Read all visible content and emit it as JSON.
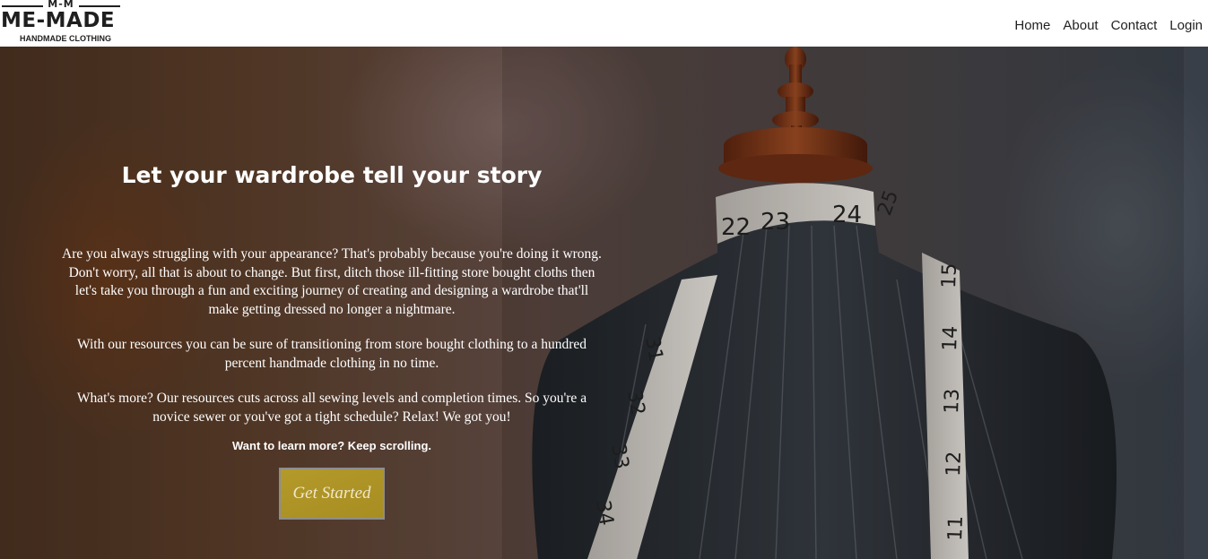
{
  "brand": {
    "top_letters": "M-M",
    "name": "ME-MADE",
    "tagline": "HANDMADE CLOTHING"
  },
  "nav": {
    "items": [
      {
        "label": "Home"
      },
      {
        "label": "About"
      },
      {
        "label": "Contact"
      },
      {
        "label": "Login"
      }
    ]
  },
  "hero": {
    "title": "Let your wardrobe tell your story",
    "paragraphs": [
      "Are you always struggling with your appearance? That's probably because you're doing it wrong. Don't worry, all that is about to change. But first, ditch those ill-fitting store bought cloths then let's take you through a fun and exciting journey of creating and designing a wardrobe that'll make getting dressed no longer a nightmare.",
      "With our resources you can be sure of transitioning from store bought clothing to a hundred percent handmade clothing in no time.",
      "What's more? Our resources cuts across all sewing levels and completion times. So you're a novice sewer or you've got a tight schedule? Relax! We got you!"
    ],
    "note": "Want to learn more? Keep scrolling.",
    "cta_label": "Get Started",
    "tape_numbers_neck": [
      "22",
      "23",
      "24",
      "25"
    ],
    "tape_numbers_left": [
      "31",
      "32",
      "33",
      "34"
    ],
    "tape_numbers_right": [
      "15",
      "14",
      "13",
      "12",
      "11"
    ]
  },
  "colors": {
    "accent": "#b39a2a",
    "nav_bg": "#ffffff",
    "text_dark": "#222222"
  }
}
